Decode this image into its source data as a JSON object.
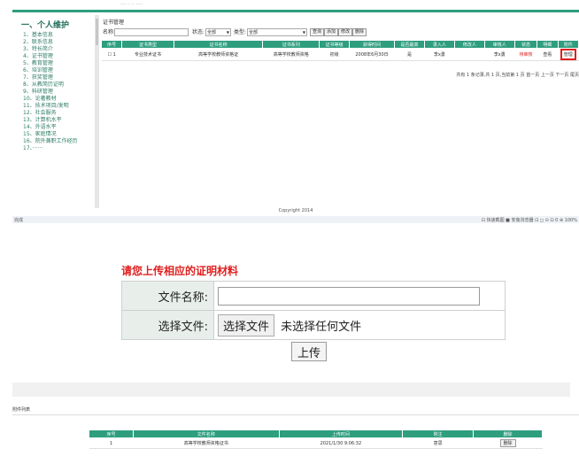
{
  "window": {
    "header_ghost": "···· ·· ·· ·····"
  },
  "sidebar": {
    "heading": "一、个人维护",
    "items": [
      "1、基本信息",
      "2、联系信息",
      "3、特长简介",
      "4、证书管理",
      "5、教育管理",
      "6、培训管理",
      "7、获奖管理",
      "8、从教简历证明",
      "9、科研管理",
      "10、论著教材",
      "11、技术项目/发明",
      "12、社会服务",
      "13、计算机水平",
      "14、外语水平",
      "15、家庭情况",
      "16、院外兼职工作经历",
      "17、······"
    ]
  },
  "certificates": {
    "page_title": "证书管理",
    "filter": {
      "name_label": "名称:",
      "name_value": "",
      "status_label": "状态:",
      "status_value": "全部",
      "type_label": "类型:",
      "type_value": "全部",
      "query": "查询",
      "add": "添加",
      "edit": "修改",
      "delete": "删除"
    },
    "columns": [
      "序号",
      "证书类型",
      "证书名称",
      "证书系列",
      "证书等级",
      "获得时间",
      "是否最高",
      "录入人",
      "修改人",
      "审核人",
      "状态",
      "明细",
      "附件"
    ],
    "rows": [
      {
        "no": "1",
        "type": "专业技术证书",
        "name": "高等学校教师资格证",
        "series": "高等学校教师资格",
        "level": "初级",
        "date": "2008年6月30日",
        "highest": "是",
        "creator": "李x勇",
        "modifier": "",
        "auditor": "李x勇",
        "status": "待审核",
        "detail": "查看",
        "attachment": "管理"
      }
    ],
    "pager": "共有 1 条记录,共 1 页,当前第 1 页 首一页 上一页 下一页 尾页"
  },
  "footer": {
    "copyright": "Copyright 2014"
  },
  "statusbar": {
    "left": "完成",
    "right": "⊡ 快速截图 ■ 安装浏览器 ⊡ ◻ ⊙ ⊡ 0 ⊕ 100%"
  },
  "upload": {
    "title": "请您上传相应的证明材料",
    "file_name_label": "文件名称:",
    "file_name_value": "",
    "choose_label": "选择文件:",
    "choose_button": "选择文件",
    "no_file": "未选择任何文件",
    "submit": "上传"
  },
  "attachments": {
    "title": "附件列表",
    "columns": [
      "序号",
      "文件名称",
      "上传时间",
      "附注",
      "删除"
    ],
    "rows": [
      {
        "no": "1",
        "name": "高等学校教师资格证书",
        "time": "2021/1/30 9:06:32",
        "note": "意思",
        "delete": "删除"
      }
    ]
  }
}
